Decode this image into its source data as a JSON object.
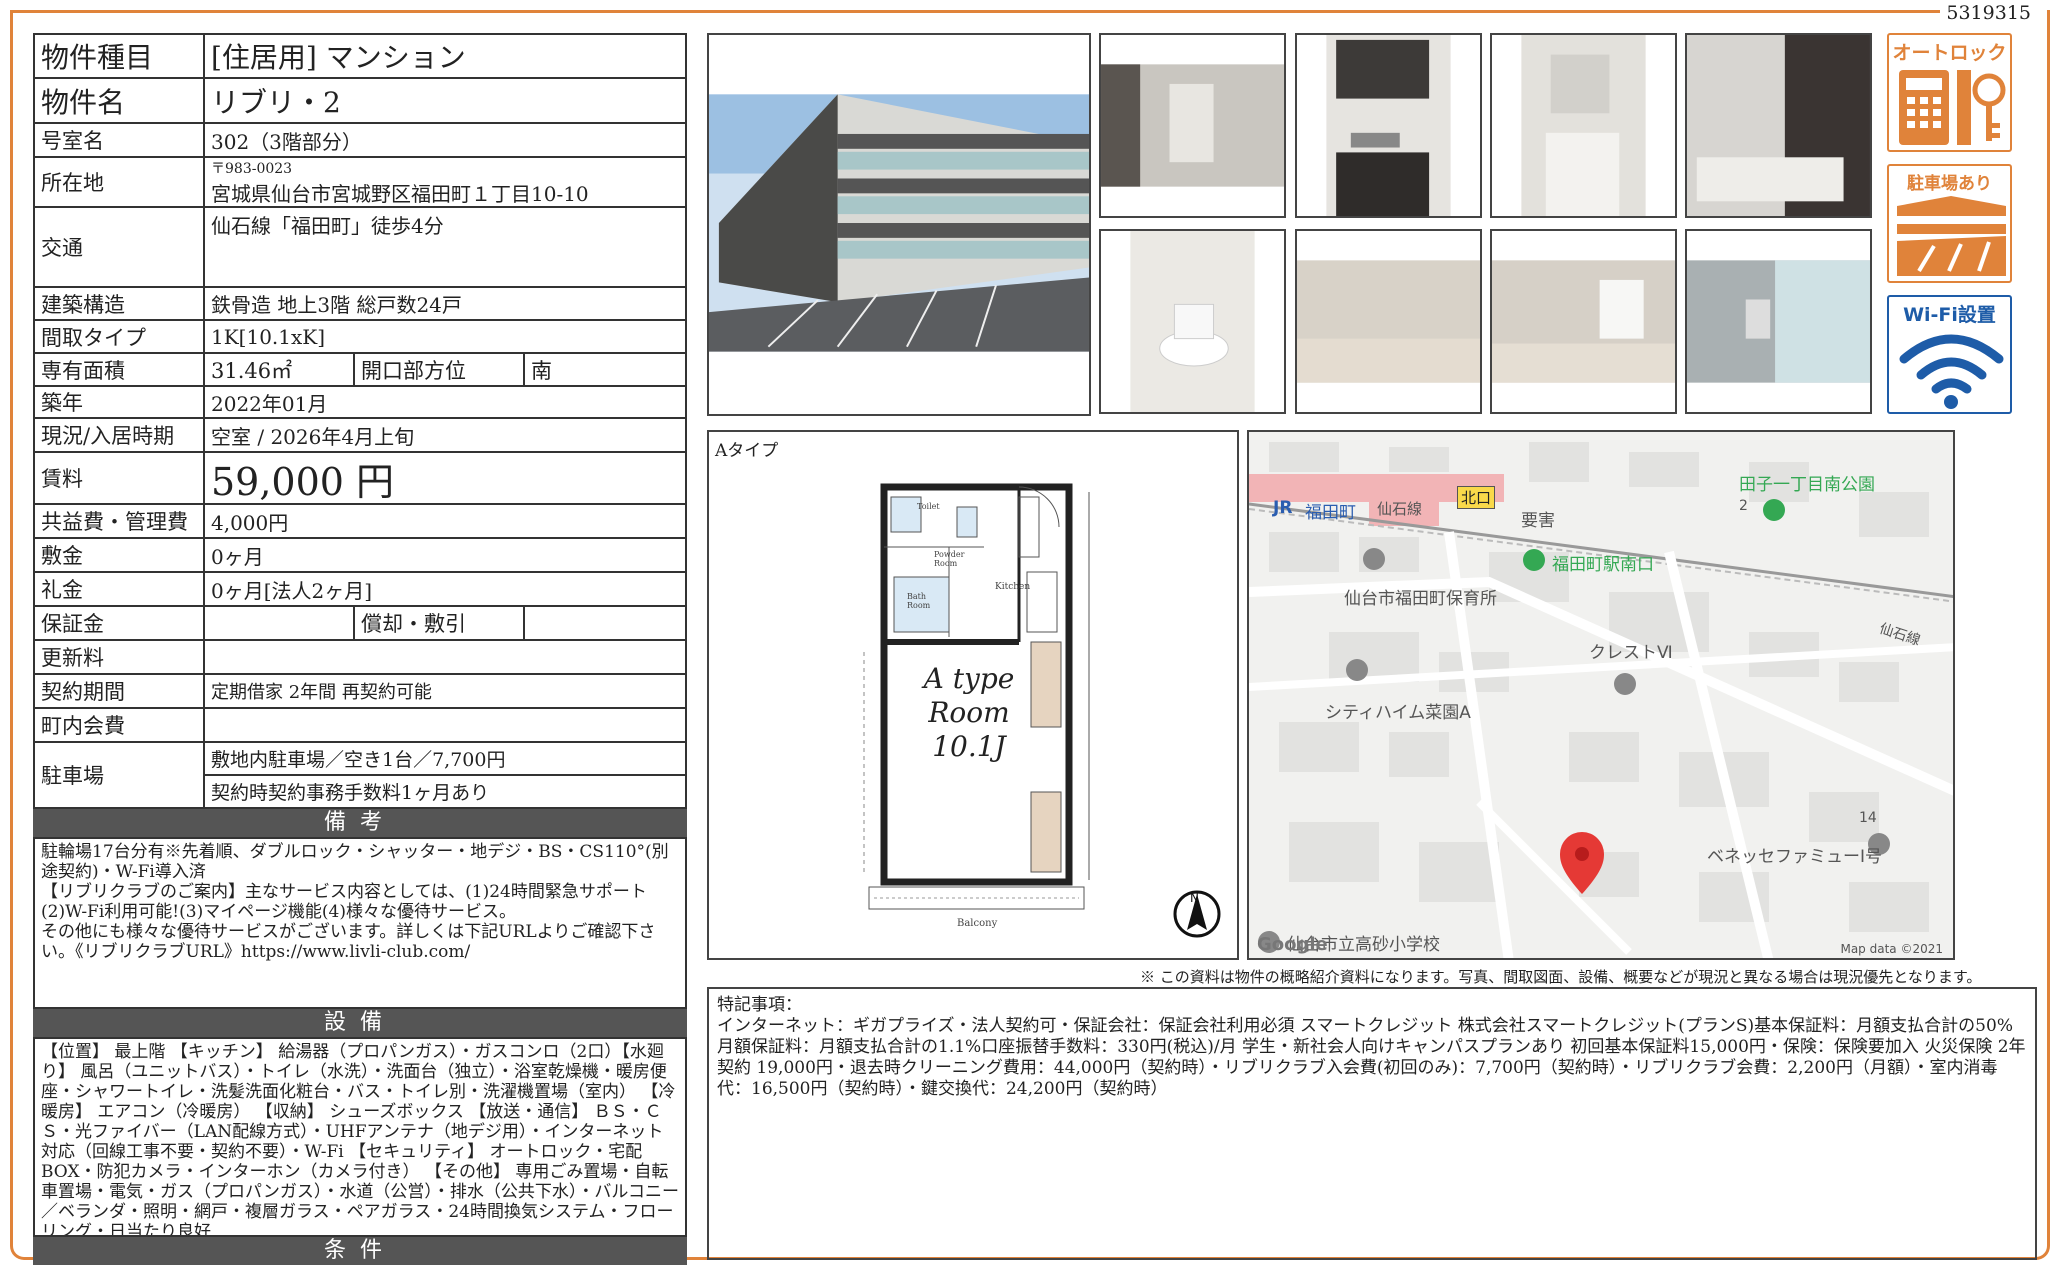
{
  "doc_number": "5319315",
  "property": {
    "type_label": "物件種目",
    "type_value": "[住居用] マンション",
    "name_label": "物件名",
    "name_value": "リブリ・2",
    "room_label": "号室名",
    "room_value": "302（3階部分）",
    "address_label": "所在地",
    "postal": "〒983-0023",
    "address": "宮城県仙台市宮城野区福田町１丁目10-10",
    "access_label": "交通",
    "access_value": "仙石線「福田町」徒歩4分",
    "structure_label": "建築構造",
    "structure_value": "鉄骨造 地上3階 総戸数24戸",
    "layout_label": "間取タイプ",
    "layout_value": "1K[10.1xK]",
    "area_label": "専有面積",
    "area_value": "31.46㎡",
    "direction_label": "開口部方位",
    "direction_value": "南",
    "built_label": "築年",
    "built_value": "2022年01月",
    "status_label": "現況/入居時期",
    "status_value": "空室 / 2026年4月上旬",
    "rent_label": "賃料",
    "rent_value": "59,000 円",
    "fee_label": "共益費・管理費",
    "fee_value": "4,000円",
    "deposit_label": "敷金",
    "deposit_value": "0ヶ月",
    "key_money_label": "礼金",
    "key_money_value": "0ヶ月[法人2ヶ月]",
    "guarantee_label": "保証金",
    "amort_label": "償却・敷引",
    "renewal_label": "更新料",
    "contract_label": "契約期間",
    "contract_value": "定期借家 2年間 再契約可能",
    "town_label": "町内会費",
    "parking_label": "駐車場",
    "parking_value1": "敷地内駐車場／空き1台／7,700円",
    "parking_value2": "契約時契約事務手数料1ヶ月あり"
  },
  "sections": {
    "notes_title": "備考",
    "notes_text": "駐輪場17台分有※先着順、ダブルロック・シャッター・地デジ・BS・CS110°(別途契約)・W-Fi導入済\n【リブリクラブのご案内】主なサービス内容としては、(1)24時間緊急サポート(2)W-Fi利用可能!(3)マイページ機能(4)様々な優待サービス。\nその他にも様々な優待サービスがございます。詳しくは下記URLよりご確認下さい。《リブリクラブURL》https://www.livli-club.com/",
    "equip_title": "設備",
    "equip_text": "【位置】 最上階 【キッチン】 給湯器（プロパンガス）・ガスコンロ（2口）【水廻り】 風呂（ユニットバス）・トイレ（水洗）・洗面台（独立）・浴室乾燥機・暖房便座・シャワートイレ・洗髪洗面化粧台・バス・トイレ別・洗濯機置場（室内） 【冷暖房】 エアコン（冷暖房） 【収納】 シューズボックス 【放送・通信】 ＢＳ・ＣＳ・光ファイバー（LAN配線方式）・UHFアンテナ（地デジ用）・インターネット対応（回線工事不要・契約不要）・W-Fi 【セキュリティ】 オートロック・宅配BOX・防犯カメラ・インターホン（カメラ付き） 【その他】 専用ごみ置場・自転車置場・電気・ガス（プロパンガス）・水道（公営）・排水（公共下水）・バルコニー／ベランダ・照明・網戸・複層ガラス・ペアガラス・24時間換気システム・フローリング・日当たり良好",
    "cond_title": "条件"
  },
  "icons": {
    "autolock": "オートロック",
    "parking": "駐車場あり",
    "wifi": "Wi-Fi設置"
  },
  "plan": {
    "type_label": "Aタイプ",
    "room_text1": "A type",
    "room_text2": "Room",
    "room_text3": "10.1J",
    "balcony": "Balcony",
    "kitchen": "Kitchen",
    "toilet": "Toilet",
    "powder": "Powder Room",
    "bath": "Bath Room"
  },
  "map": {
    "jr": "JR",
    "station": "福田町",
    "line1": "仙石線",
    "north_exit": "北口",
    "youkai": "要害",
    "park": "田子一丁目南公園",
    "park_num": "2",
    "south_exit": "福田町駅南口",
    "nursery": "仙台市福田町保育所",
    "line2": "仙石線",
    "crest": "クレストⅥ",
    "city_heim": "シティハイム菜園A",
    "num14": "14",
    "benesse": "ベネッセファミューⅠ号",
    "school": "仙台市立高砂小学校",
    "google": "Google",
    "mapdata": "Map data ©2021"
  },
  "disclaimer": "※ この資料は物件の概略紹介資料になります。写真、間取図面、設備、概要などが現況と異なる場合は現況優先となります。",
  "remarks": {
    "title": "特記事項：",
    "text": "インターネット：ギガプライズ・法人契約可・保証会社：保証会社利用必須 スマートクレジット 株式会社スマートクレジット(プランS)基本保証料：月額支払合計の50%月額保証料：月額支払合計の1.1%口座振替手数料：330円(税込)/月 学生・新社会人向けキャンパスプランあり 初回基本保証料15,000円・保険：保険要加入 火災保険 2年契約 19,000円・退去時クリーニング費用：44,000円（契約時）・リブリクラブ入会費(初回のみ)：7,700円（契約時）・リブリクラブ会費：2,200円（月額）・室内消毒代：16,500円（契約時）・鍵交換代：24,200円（契約時）"
  },
  "colors": {
    "accent": "#e0833a",
    "wifi": "#1e5ca8",
    "bar": "#555555",
    "pin": "#e53935"
  }
}
